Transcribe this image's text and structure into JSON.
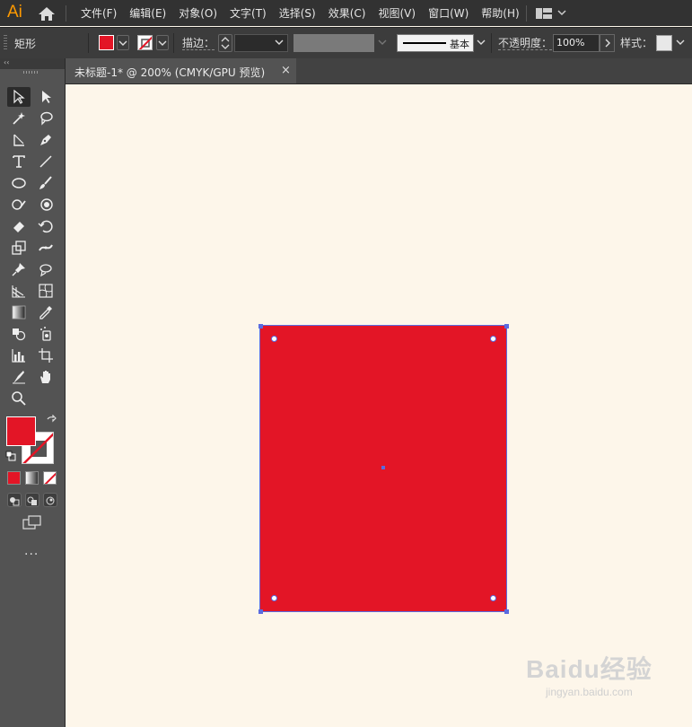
{
  "app": {
    "logo": "Ai"
  },
  "menubar": {
    "items": [
      "文件(F)",
      "编辑(E)",
      "对象(O)",
      "文字(T)",
      "选择(S)",
      "效果(C)",
      "视图(V)",
      "窗口(W)",
      "帮助(H)"
    ]
  },
  "controlbar": {
    "tool_name": "矩形",
    "stroke_label": "描边：",
    "brush_label": "基本",
    "opacity_label": "不透明度：",
    "opacity_value": "100%",
    "style_label": "样式：",
    "fill_color": "#e31526"
  },
  "document": {
    "tab_title": "未标题-1* @ 200% (CMYK/GPU 预览)",
    "close_glyph": "×"
  },
  "toolpanel": {
    "collapse_glyph": "‹‹",
    "more_tools": "..."
  },
  "canvas": {
    "background": "#fdf6ea",
    "rectangle_fill": "#e31526",
    "selection_color": "#5a6be0"
  },
  "watermark": {
    "main": "Baidu经验",
    "sub": "jingyan.baidu.com"
  }
}
